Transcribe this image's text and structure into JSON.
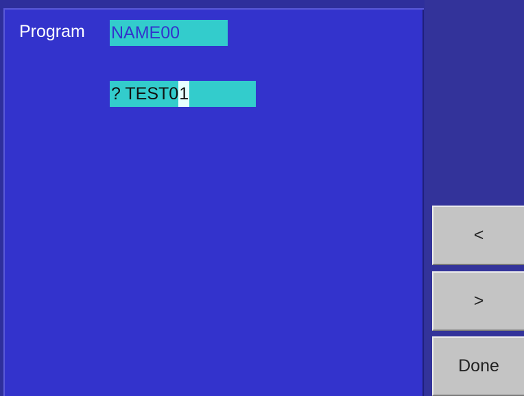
{
  "main": {
    "program_label": "Program",
    "program_name": "NAME00",
    "prompt": "? ",
    "new_name_before_cursor": "TEST0",
    "new_name_cursor_char": "1"
  },
  "softkeys": {
    "prev_label": "<",
    "next_label": ">",
    "done_label": "Done"
  },
  "colors": {
    "background": "#2e2f9c",
    "panel": "#3333cc",
    "field": "#33cccc",
    "softkey": "#c4c4c4"
  }
}
